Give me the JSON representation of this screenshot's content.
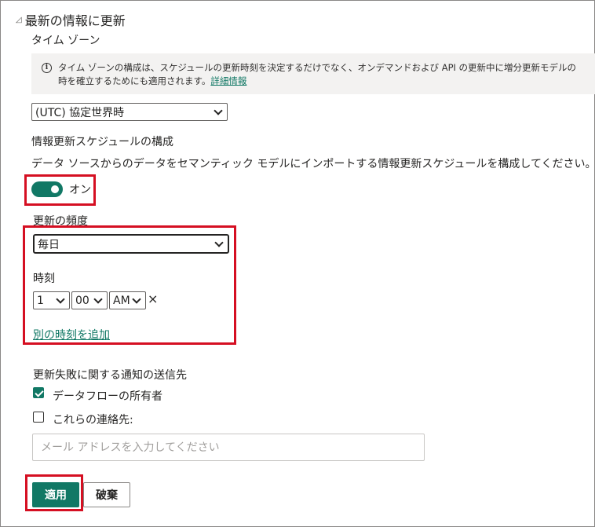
{
  "section": {
    "title": "最新の情報に更新",
    "collapse_icon": "triangle-down-icon"
  },
  "timezone": {
    "label": "タイム ゾーン",
    "info_line1": "タイム ゾーンの構成は、スケジュールの更新時刻を決定するだけでなく、オンデマンドおよび API の更新中に増分更新モデルの",
    "info_line2": "時を確立するためにも適用されます。",
    "info_link": "詳細情報",
    "selected": "(UTC) 協定世界時"
  },
  "schedule": {
    "heading": "情報更新スケジュールの構成",
    "description": "データ ソースからのデータをセマンティック モデルにインポートする情報更新スケジュールを構成してください。",
    "toggle_label": "オン",
    "toggle_on": true
  },
  "frequency": {
    "label": "更新の頻度",
    "selected": "毎日",
    "time_label": "時刻",
    "hour": "1",
    "minute": "00",
    "ampm": "AM",
    "remove_icon": "×",
    "add_time_link": "別の時刻を追加"
  },
  "notify": {
    "heading": "更新失敗に関する通知の送信先",
    "owner_label": "データフローの所有者",
    "owner_checked": true,
    "contacts_label": "これらの連絡先:",
    "contacts_checked": false,
    "email_placeholder": "メール アドレスを入力してください"
  },
  "actions": {
    "apply": "適用",
    "discard": "破棄"
  },
  "colors": {
    "accent": "#117865",
    "highlight": "#d50f22",
    "info_bg": "#f3f2f1"
  }
}
